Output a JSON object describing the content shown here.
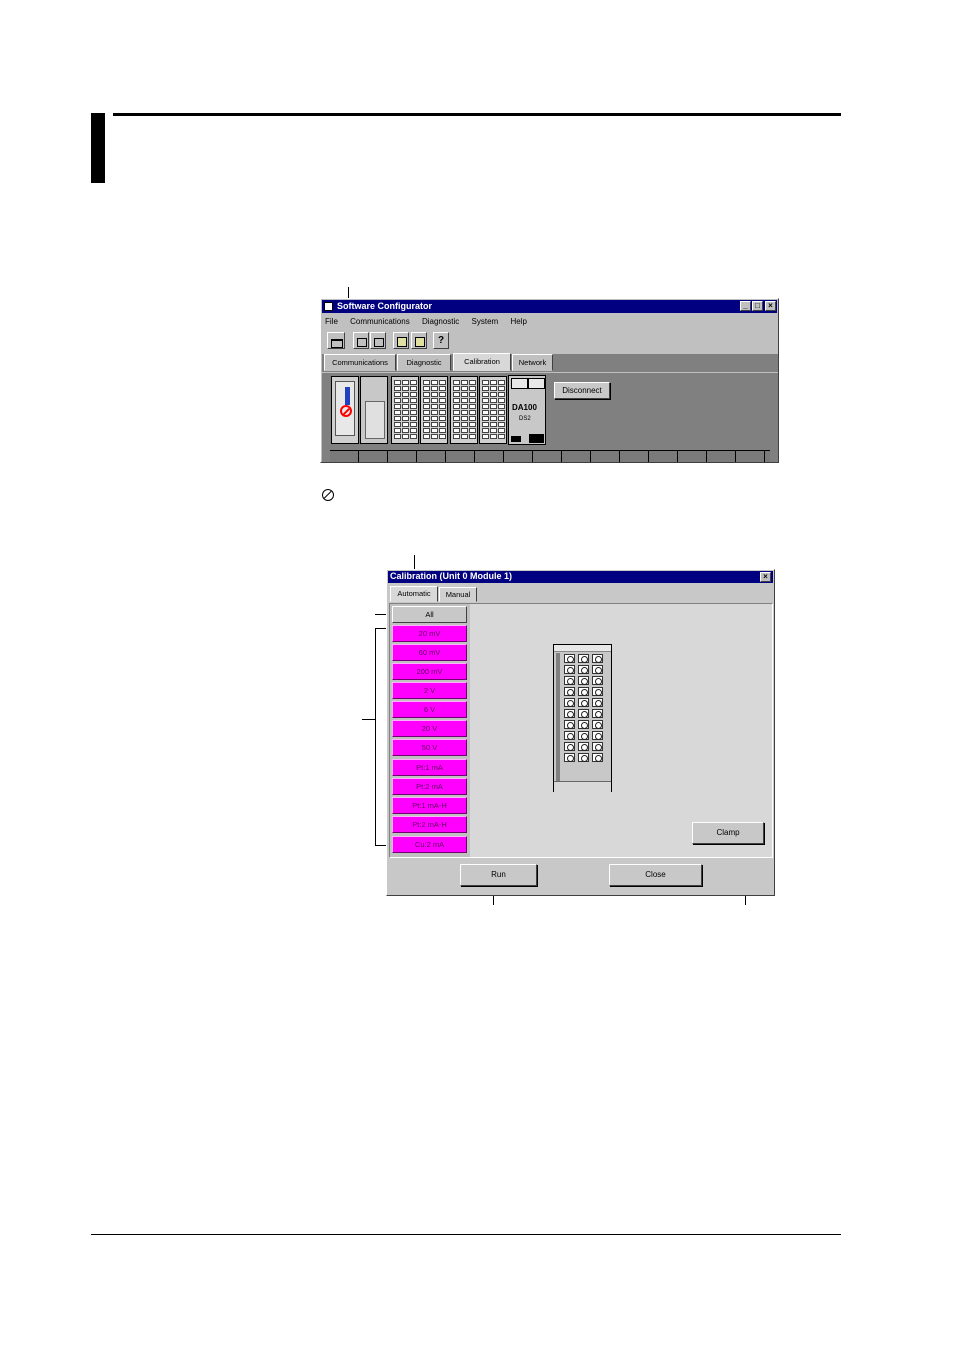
{
  "main_window": {
    "title": "Software Configurator",
    "controls": [
      "_",
      "□",
      "×"
    ],
    "menu": [
      "File",
      "Communications",
      "Diagnostic",
      "System",
      "Help"
    ],
    "toolbar_icons": [
      "unit-list-icon",
      "unit-up-icon",
      "unit-down-icon",
      "print-icon",
      "upload-icon",
      "help-icon"
    ],
    "tabs": [
      "Communications",
      "Diagnostic",
      "Calibration",
      "Network"
    ],
    "active_tab": "Calibration",
    "disconnect_label": "Disconnect",
    "base_module": {
      "brand": "DA100",
      "model": "DS2"
    }
  },
  "legend_icon": "disabled-icon",
  "calibration_dialog": {
    "title": "Calibration (Unit 0 Module 1)",
    "close_glyph": "×",
    "tabs": [
      "Automatic",
      "Manual"
    ],
    "active_tab": "Automatic",
    "all_label": "All",
    "ranges": [
      "20 mV",
      "60 mV",
      "200 mV",
      "2 V",
      "6 V",
      "20 V",
      "50 V",
      "Pt:1 mA",
      "Pt:2 mA",
      "Pt:1 mA-H",
      "Pt:2 mA-H",
      "Cu:2 mA"
    ],
    "clamp_label": "Clamp",
    "run_label": "Run",
    "close_label": "Close"
  }
}
